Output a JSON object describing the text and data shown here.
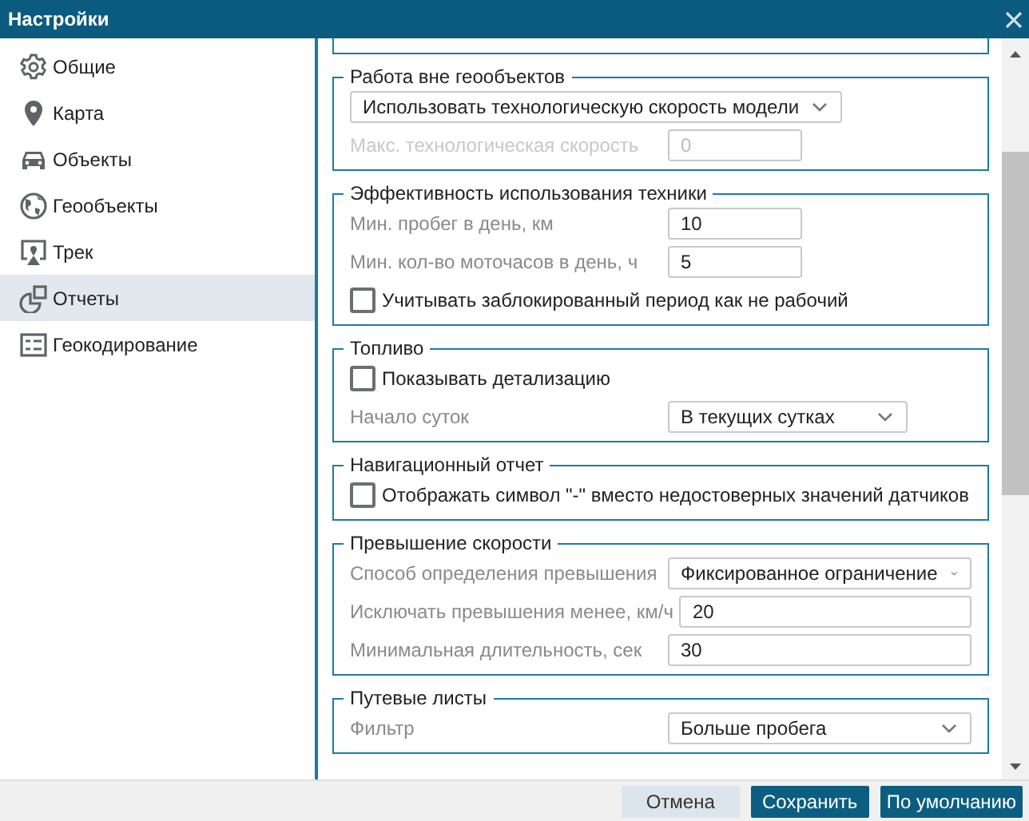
{
  "window": {
    "title": "Настройки"
  },
  "sidebar": {
    "items": [
      {
        "label": "Общие",
        "selected": false
      },
      {
        "label": "Карта",
        "selected": false
      },
      {
        "label": "Объекты",
        "selected": false
      },
      {
        "label": "Геообъекты",
        "selected": false
      },
      {
        "label": "Трек",
        "selected": false
      },
      {
        "label": "Отчеты",
        "selected": true
      },
      {
        "label": "Геокодирование",
        "selected": false
      }
    ]
  },
  "sections": [
    {
      "legend": "Работа вне геообъектов",
      "rows": [
        {
          "kind": "select",
          "value": "Использовать технологическую скорость модели"
        },
        {
          "kind": "input",
          "label": "Макс. технологическая скорость",
          "value": "0",
          "disabled": true
        }
      ]
    },
    {
      "legend": "Эффективность использования техники",
      "rows": [
        {
          "kind": "input",
          "label": "Мин. пробег в день, км",
          "value": "10",
          "disabled": false
        },
        {
          "kind": "input",
          "label": "Мин. кол-во моточасов в день, ч",
          "value": "5",
          "disabled": false
        },
        {
          "kind": "checkbox",
          "label": "Учитывать заблокированный период как не рабочий",
          "checked": false
        }
      ]
    },
    {
      "legend": "Топливо",
      "rows": [
        {
          "kind": "checkbox",
          "label": "Показывать детализацию",
          "checked": false
        },
        {
          "kind": "labeled-select",
          "label": "Начало суток",
          "value": "В текущих сутках"
        }
      ]
    },
    {
      "legend": "Навигационный отчет",
      "rows": [
        {
          "kind": "checkbox",
          "label": "Отображать символ \"-\" вместо недостоверных значений датчиков",
          "checked": false
        }
      ]
    },
    {
      "legend": "Превышение скорости",
      "rows": [
        {
          "kind": "labeled-select",
          "label": "Способ определения превышения",
          "value": "Фиксированное ограничение"
        },
        {
          "kind": "input",
          "label": "Исключать превышения менее, км/ч",
          "value": "20",
          "disabled": false
        },
        {
          "kind": "input",
          "label": "Минимальная длительность, сек",
          "value": "30",
          "disabled": false
        }
      ]
    },
    {
      "legend": "Путевые листы",
      "rows": [
        {
          "kind": "labeled-select",
          "label": "Фильтр",
          "value": "Больше пробега"
        }
      ]
    }
  ],
  "buttons": [
    {
      "label": "Отмена",
      "kind": "secondary"
    },
    {
      "label": "Сохранить",
      "kind": "primary"
    },
    {
      "label": "По умолчанию",
      "kind": "primary"
    }
  ]
}
